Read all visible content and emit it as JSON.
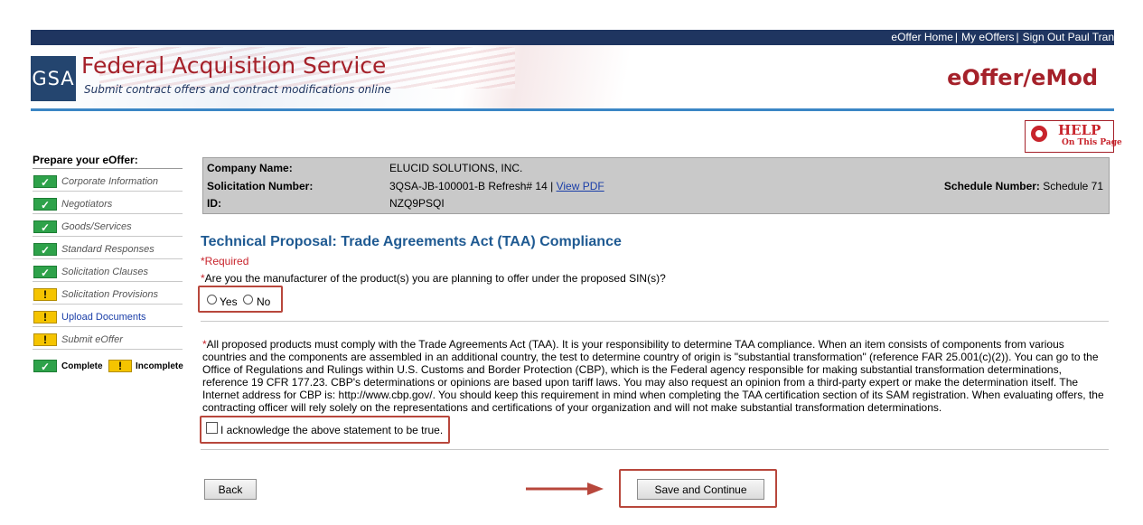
{
  "header": {
    "links": [
      "eOffer Home",
      "My eOffers",
      "Sign Out Paul Tran"
    ],
    "logo_text": "GSA",
    "title": "Federal Acquisition Service",
    "subtitle": "Submit contract offers and contract modifications online",
    "app_name": "eOffer/eMod"
  },
  "help": {
    "icon": "lifebuoy-icon",
    "title": "HELP",
    "subtitle": "On This Page"
  },
  "sidebar": {
    "title": "Prepare your eOffer:",
    "items": [
      {
        "label": "Corporate Information",
        "status": "complete"
      },
      {
        "label": "Negotiators",
        "status": "complete"
      },
      {
        "label": "Goods/Services",
        "status": "complete"
      },
      {
        "label": "Standard Responses",
        "status": "complete"
      },
      {
        "label": "Solicitation Clauses",
        "status": "complete"
      },
      {
        "label": "Solicitation Provisions",
        "status": "incomplete"
      },
      {
        "label": "Upload Documents",
        "status": "incomplete"
      },
      {
        "label": "Submit eOffer",
        "status": "incomplete"
      }
    ],
    "legend": {
      "complete": "Complete",
      "incomplete": "Incomplete"
    }
  },
  "info": {
    "company_label": "Company Name:",
    "company_value": "ELUCID SOLUTIONS, INC.",
    "solicitation_label": "Solicitation Number:",
    "solicitation_value": "3QSA-JB-100001-B Refresh# 14 |",
    "view_pdf": "View PDF",
    "id_label": "ID:",
    "id_value": "NZQ9PSQI",
    "schedule_label": "Schedule Number:",
    "schedule_value": "Schedule 71"
  },
  "main": {
    "title": "Technical Proposal: Trade Agreements Act (TAA) Compliance",
    "required": "*Required",
    "question_star": "*",
    "question": "Are you the manufacturer of the product(s) you are planning to offer under the proposed SIN(s)?",
    "yes": "Yes",
    "no": "No",
    "taa_star": "*",
    "taa_text": "All proposed products must comply with the Trade Agreements Act (TAA). It is your responsibility to determine TAA compliance. When an item consists of components from various countries and the components are assembled in an additional country, the test to determine country of origin is \"substantial transformation\" (reference FAR 25.001(c)(2)). You can go to the Office of Regulations and Rulings within U.S. Customs and Border Protection (CBP), which is the Federal agency responsible for making substantial transformation determinations, reference 19 CFR 177.23. CBP's determinations or opinions are based upon tariff laws. You may also request an opinion from a third-party expert or make the determination itself. The Internet address for CBP is: http://www.cbp.gov/. You should keep this requirement in mind when completing the TAA certification section of its SAM registration. When evaluating offers, the contracting officer will rely solely on the representations and certifications of your organization and will not make substantial transformation determinations.",
    "ack_label": "I acknowledge the above statement to be true.",
    "back": "Back",
    "save": "Save and Continue"
  },
  "colors": {
    "brand_red": "#a5212a",
    "navy": "#1f3560",
    "title_blue": "#1f5a92",
    "complete_green": "#2ea24a",
    "incomplete_yellow": "#f5c400",
    "callout_border": "#b8473c"
  }
}
